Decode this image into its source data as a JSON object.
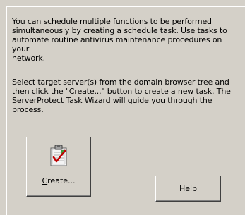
{
  "intro": {
    "paragraph1": "You can schedule multiple functions to be performed\nsimultaneously by creating a schedule task. Use tasks to\nautomate routine antivirus maintenance procedures on your\nnetwork.",
    "paragraph2": "Select target server(s) from the domain browser tree and\nthen click the \"Create...\" button to create a new task. The\nServerProtect Task Wizard will guide you through the\nprocess."
  },
  "buttons": {
    "create": {
      "mnemonic": "C",
      "rest": "reate...",
      "icon": "clipboard-checklist-icon"
    },
    "help": {
      "mnemonic": "H",
      "rest": "elp"
    }
  }
}
